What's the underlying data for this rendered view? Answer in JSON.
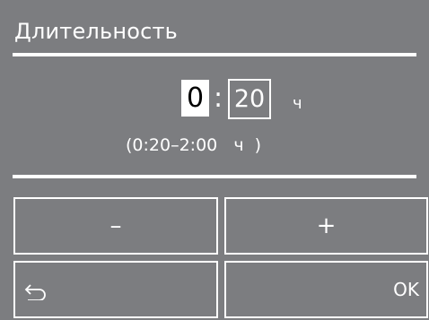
{
  "header": {
    "title": "Длительность"
  },
  "duration": {
    "hours": "0",
    "separator": ":",
    "minutes": "20",
    "unit": "ч",
    "range": "(0:20–2:00   ч  )"
  },
  "buttons": {
    "minus": "–",
    "plus": "+",
    "ok": "OK",
    "back_icon": "back-arrow-icon"
  },
  "colors": {
    "background": "#7c7d80",
    "foreground": "#ffffff",
    "selected_text": "#000000"
  }
}
